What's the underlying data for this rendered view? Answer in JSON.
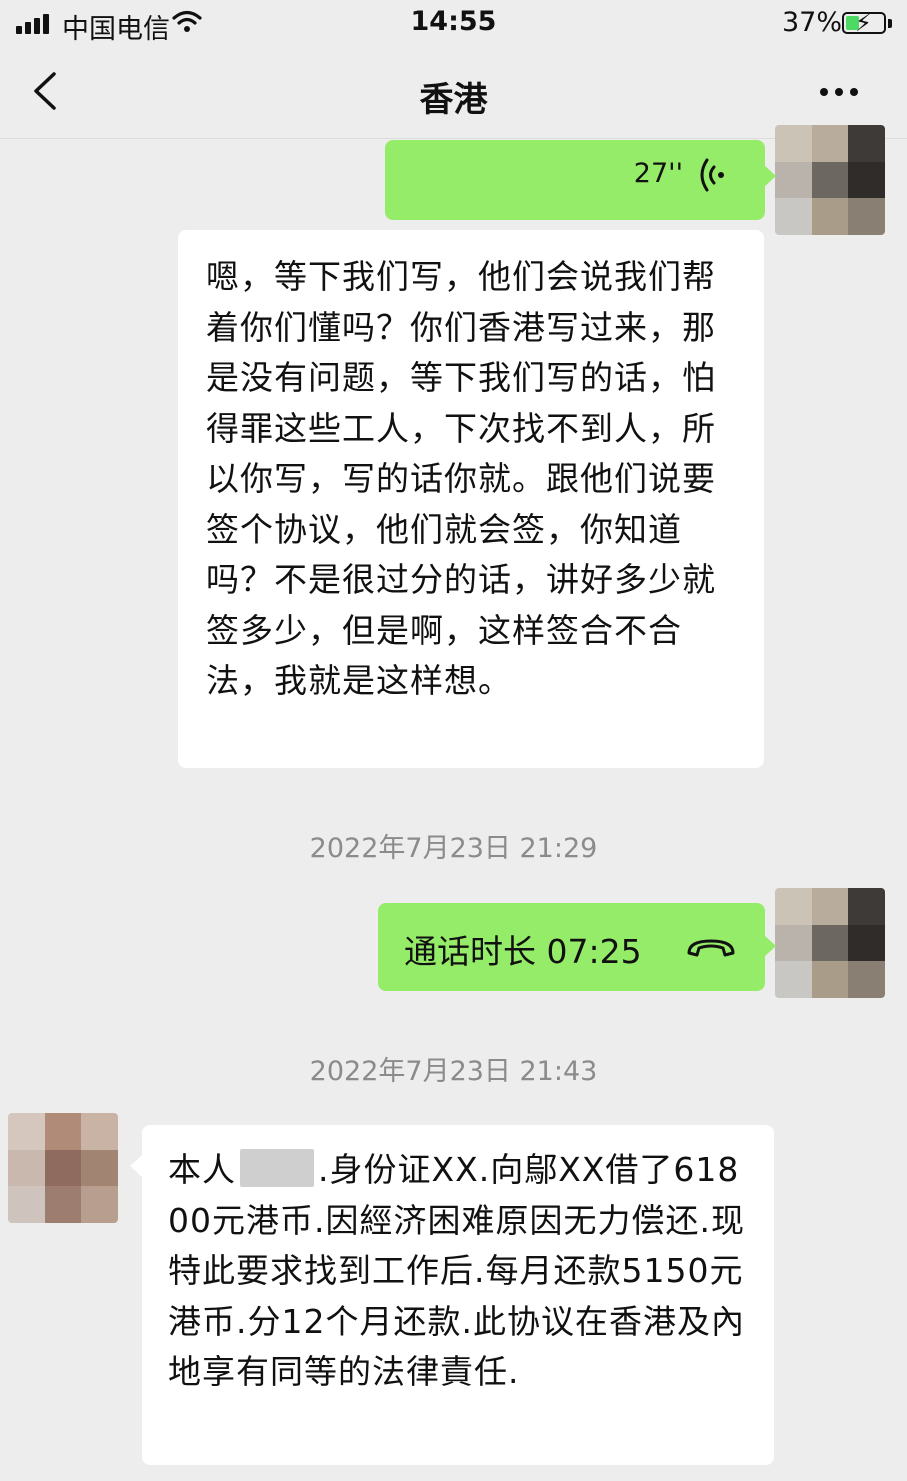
{
  "status_bar": {
    "carrier": "中国电信",
    "time": "14:55",
    "battery_percent": "37%",
    "battery_level": 0.37,
    "signal_icon": "signal-bars-icon",
    "wifi_icon": "wifi-icon",
    "battery_icon": "battery-charging-icon"
  },
  "nav": {
    "back_icon": "chevron-left-icon",
    "title": "香港",
    "more_icon": "more-dots-icon"
  },
  "messages": {
    "voice": {
      "duration": "27''",
      "icon": "voice-wave-icon"
    },
    "text_1": "嗯，等下我们写，他们会说我们帮着你们懂吗？你们香港写过来，那是没有问题，等下我们写的话，怕得罪这些工人，下次找不到人，所以你写，写的话你就。跟他们说要签个协议，他们就会签，你知道吗？不是很过分的话，讲好多少就签多少，但是啊，这样签合不合法，我就是这样想。",
    "timestamp_1": "2022年7月23日 21:29",
    "call": {
      "label": "通话时长 07:25",
      "icon": "phone-hangup-icon"
    },
    "timestamp_2": "2022年7月23日 21:43",
    "text_2_prefix": "本人",
    "text_2_body": ".身份证XX.向鄔XX借了61800元港币.因經济困难原因无力偿还.现特此要求找到工作后.每月还款5150元港币.分12个月还款.此协议在香港及內地享有同等的法律責任."
  },
  "colors": {
    "background": "#ededed",
    "sent_bubble": "#95ec69",
    "received_bubble": "#ffffff",
    "timestamp_text": "#8b8b8b"
  }
}
